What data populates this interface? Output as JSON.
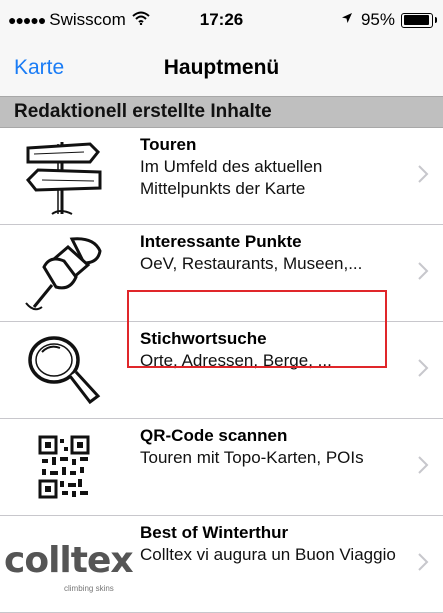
{
  "status_bar": {
    "signal_dots": "●●●●●",
    "carrier": "Swisscom",
    "wifi_icon": "wifi-icon",
    "time": "17:26",
    "location_icon": "location-arrow-icon",
    "battery_percent": "95%",
    "battery_level": 0.95
  },
  "nav": {
    "back_label": "Karte",
    "title": "Hauptmenü"
  },
  "section": {
    "header": "Redaktionell erstellte Inhalte"
  },
  "menu": [
    {
      "icon": "signpost-icon",
      "title": "Touren",
      "subtitle": "Im Umfeld des aktuellen Mittelpunkts der Karte"
    },
    {
      "icon": "pushpin-icon",
      "title": "Interessante Punkte",
      "subtitle": "OeV, Restaurants, Museen,..."
    },
    {
      "icon": "magnifier-icon",
      "title": "Stichwortsuche",
      "subtitle": "Orte, Adressen, Berge, ..."
    },
    {
      "icon": "qr-code-icon",
      "title": "QR-Code scannen",
      "subtitle": "Touren mit Topo-Karten, POIs"
    },
    {
      "icon": "colltex-logo",
      "title": "Best of Winterthur",
      "subtitle": "Colltex vi augura un Buon Viaggio",
      "logo_text": "colltex",
      "logo_tagline": "climbing skins"
    }
  ],
  "colors": {
    "accent": "#1a7cf5",
    "section_bg": "#bfbfbf",
    "highlight": "#e0262a"
  }
}
